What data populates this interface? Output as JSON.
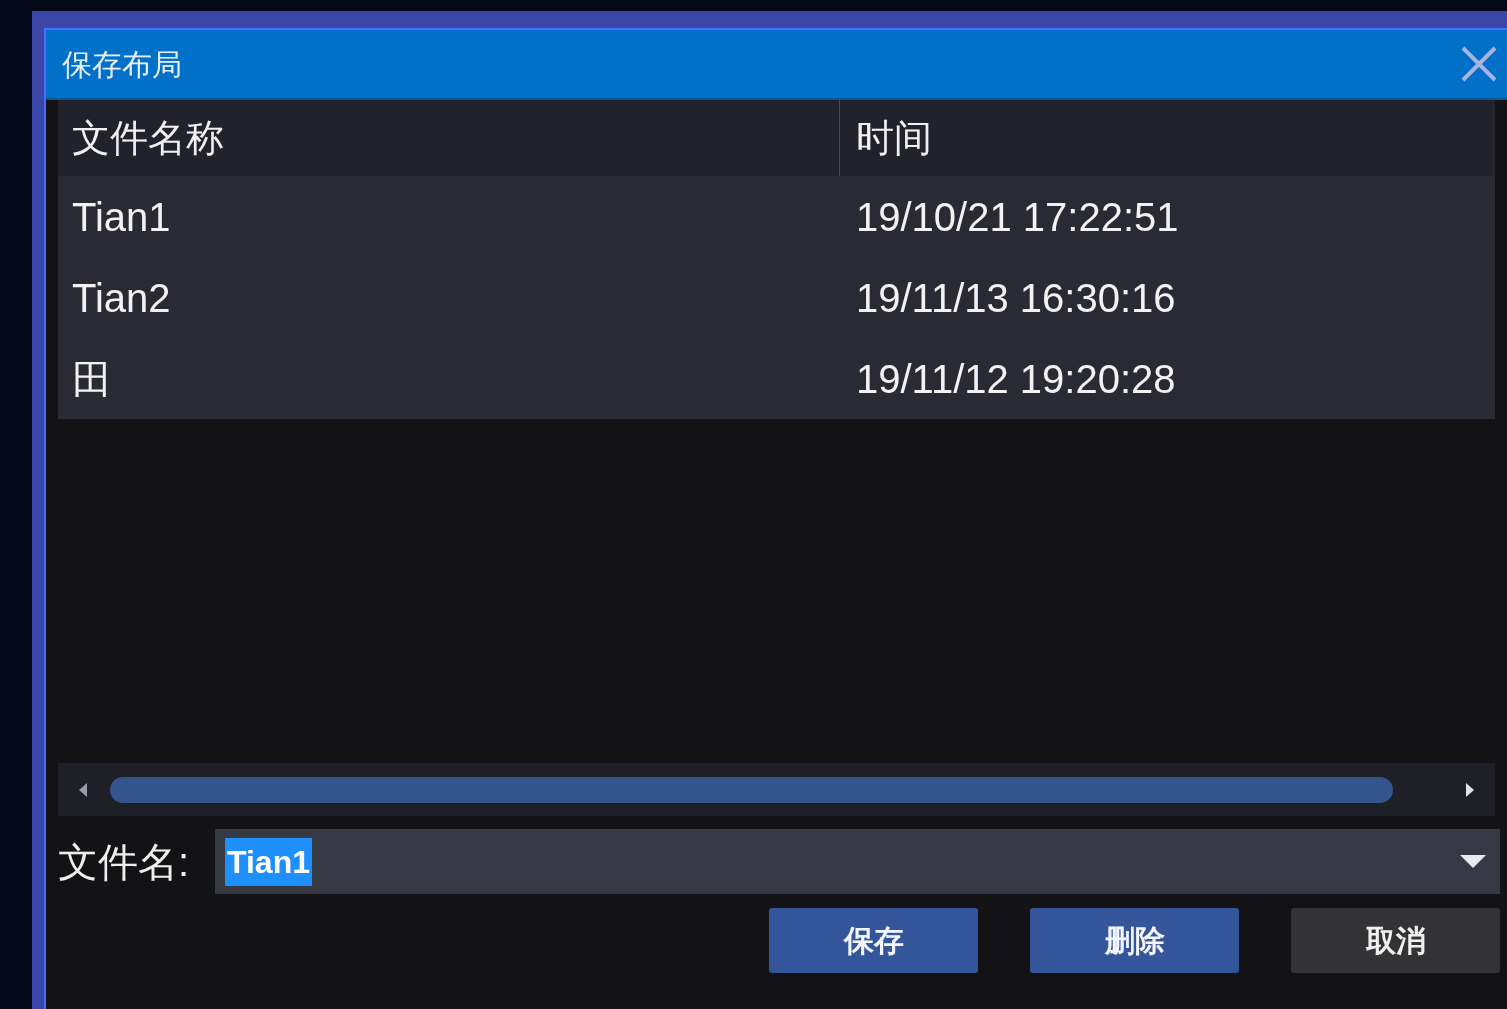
{
  "window": {
    "title": "保存布局"
  },
  "table": {
    "columns": [
      "文件名称",
      "时间"
    ],
    "rows": [
      {
        "name": "Tian1",
        "time": "19/10/21 17:22:51"
      },
      {
        "name": "Tian2",
        "time": "19/11/13 16:30:16"
      },
      {
        "name": "田",
        "time": "19/11/12 19:20:28"
      }
    ]
  },
  "filename": {
    "label": "文件名:",
    "value": "Tian1",
    "text_selected": true
  },
  "buttons": [
    {
      "label": "保存",
      "kind": "primary"
    },
    {
      "label": "删除",
      "kind": "primary"
    },
    {
      "label": "取消",
      "kind": "secondary"
    }
  ]
}
